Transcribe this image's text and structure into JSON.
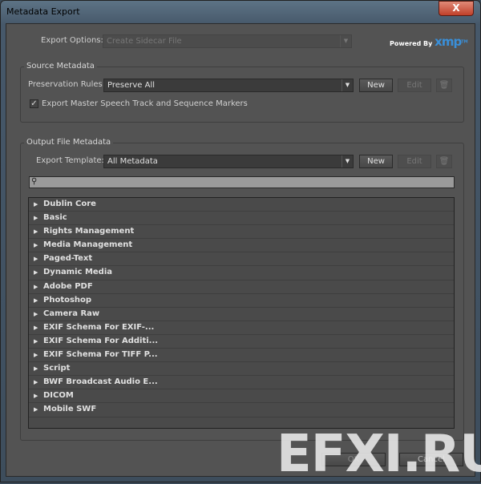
{
  "window": {
    "title": "Metadata Export",
    "close": "X"
  },
  "export_options": {
    "label": "Export Options:",
    "value": "Create Sidecar File"
  },
  "logo": {
    "powered_by": "Powered By",
    "brand": "xmp",
    "tm": "TM"
  },
  "source": {
    "title": "Source Metadata",
    "rules_label": "Preservation Rules:",
    "rules_value": "Preserve All",
    "new": "New",
    "edit": "Edit",
    "checkbox_label": "Export Master Speech Track and Sequence Markers",
    "checked": true
  },
  "output": {
    "title": "Output File Metadata",
    "template_label": "Export Template:",
    "template_value": "All Metadata",
    "new": "New",
    "edit": "Edit",
    "search_placeholder": "",
    "items": [
      "Dublin Core",
      "Basic",
      "Rights Management",
      "Media Management",
      "Paged-Text",
      "Dynamic Media",
      "Adobe PDF",
      "Photoshop",
      "Camera Raw",
      "EXIF Schema For EXIF-...",
      "EXIF Schema For Additi...",
      "EXIF Schema For TIFF P...",
      "Script",
      "BWF Broadcast Audio E...",
      "DICOM",
      "Mobile SWF"
    ]
  },
  "footer": {
    "ok": "OK",
    "cancel": "Cancel"
  },
  "watermark": "EFXI.RU"
}
